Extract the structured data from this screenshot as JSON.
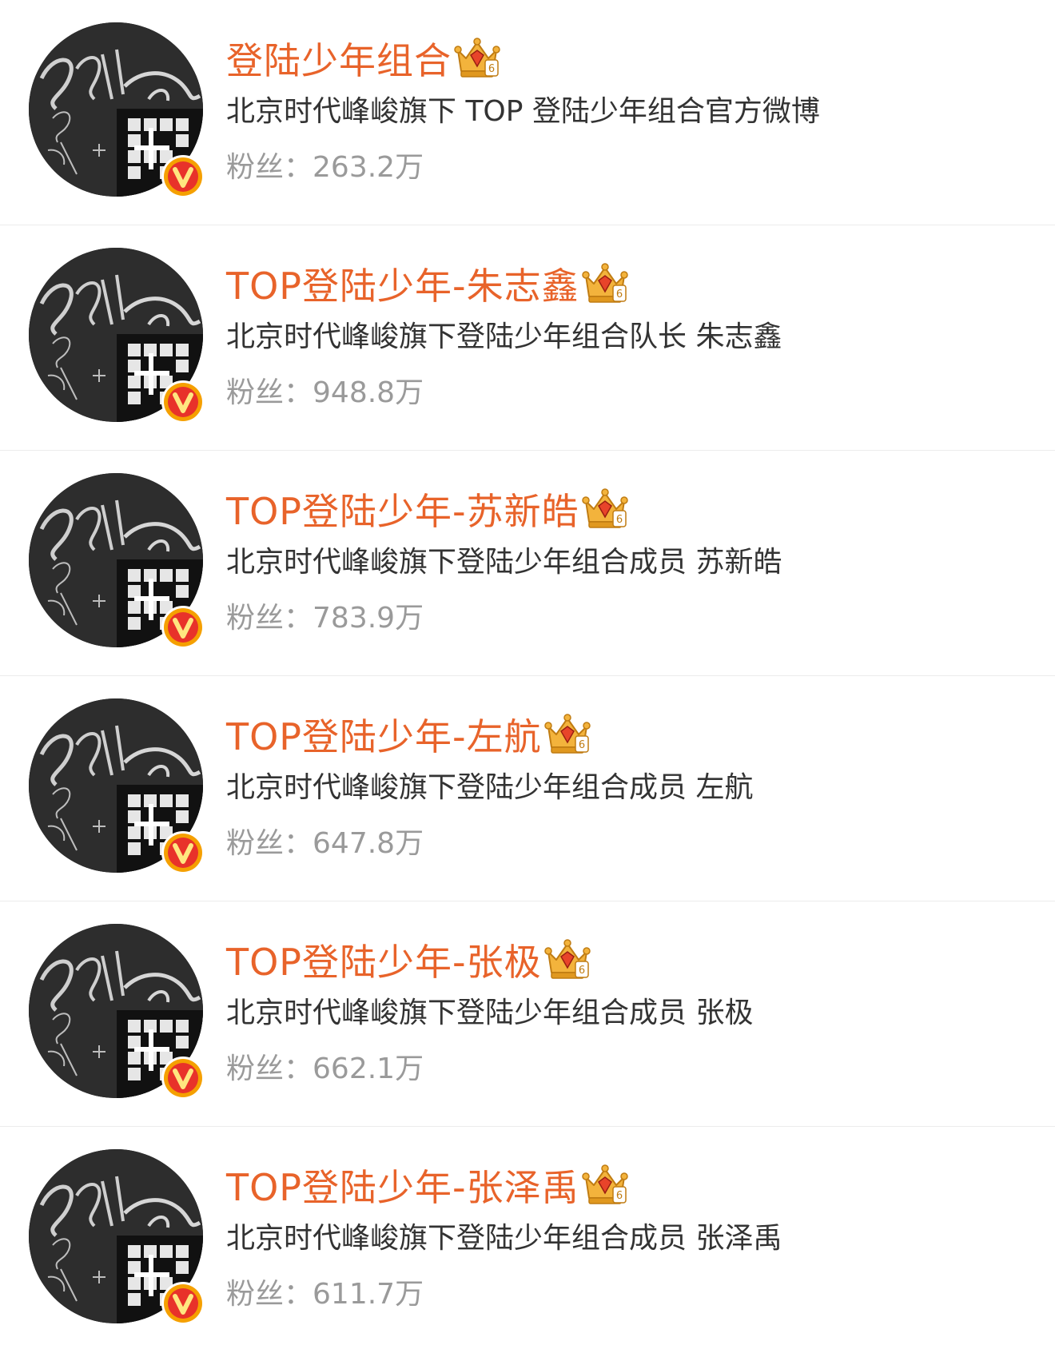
{
  "colors": {
    "name": "#e8632a",
    "description": "#333333",
    "fans": "#9a9a9a",
    "divider": "#ececec",
    "verified_badge": "#f5a000",
    "verified_badge_inner": "#e8322a"
  },
  "icons": {
    "avatar": "still-alive-poster-avatar",
    "verified": "orange-v-verified-icon",
    "member": "gold-crown-member-icon"
  },
  "accounts": [
    {
      "name": "登陆少年组合",
      "description": "北京时代峰峻旗下 TOP 登陆少年组合官方微博",
      "fans_label": "粉丝：",
      "fans_count": "263.2万"
    },
    {
      "name": "TOP登陆少年-朱志鑫",
      "description": "北京时代峰峻旗下登陆少年组合队长 朱志鑫",
      "fans_label": "粉丝：",
      "fans_count": "948.8万"
    },
    {
      "name": "TOP登陆少年-苏新皓",
      "description": "北京时代峰峻旗下登陆少年组合成员 苏新皓",
      "fans_label": "粉丝：",
      "fans_count": "783.9万"
    },
    {
      "name": "TOP登陆少年-左航",
      "description": "北京时代峰峻旗下登陆少年组合成员 左航",
      "fans_label": "粉丝：",
      "fans_count": "647.8万"
    },
    {
      "name": "TOP登陆少年-张极",
      "description": "北京时代峰峻旗下登陆少年组合成员 张极",
      "fans_label": "粉丝：",
      "fans_count": "662.1万"
    },
    {
      "name": "TOP登陆少年-张泽禹",
      "description": "北京时代峰峻旗下登陆少年组合成员 张泽禹",
      "fans_label": "粉丝：",
      "fans_count": "611.7万"
    }
  ]
}
